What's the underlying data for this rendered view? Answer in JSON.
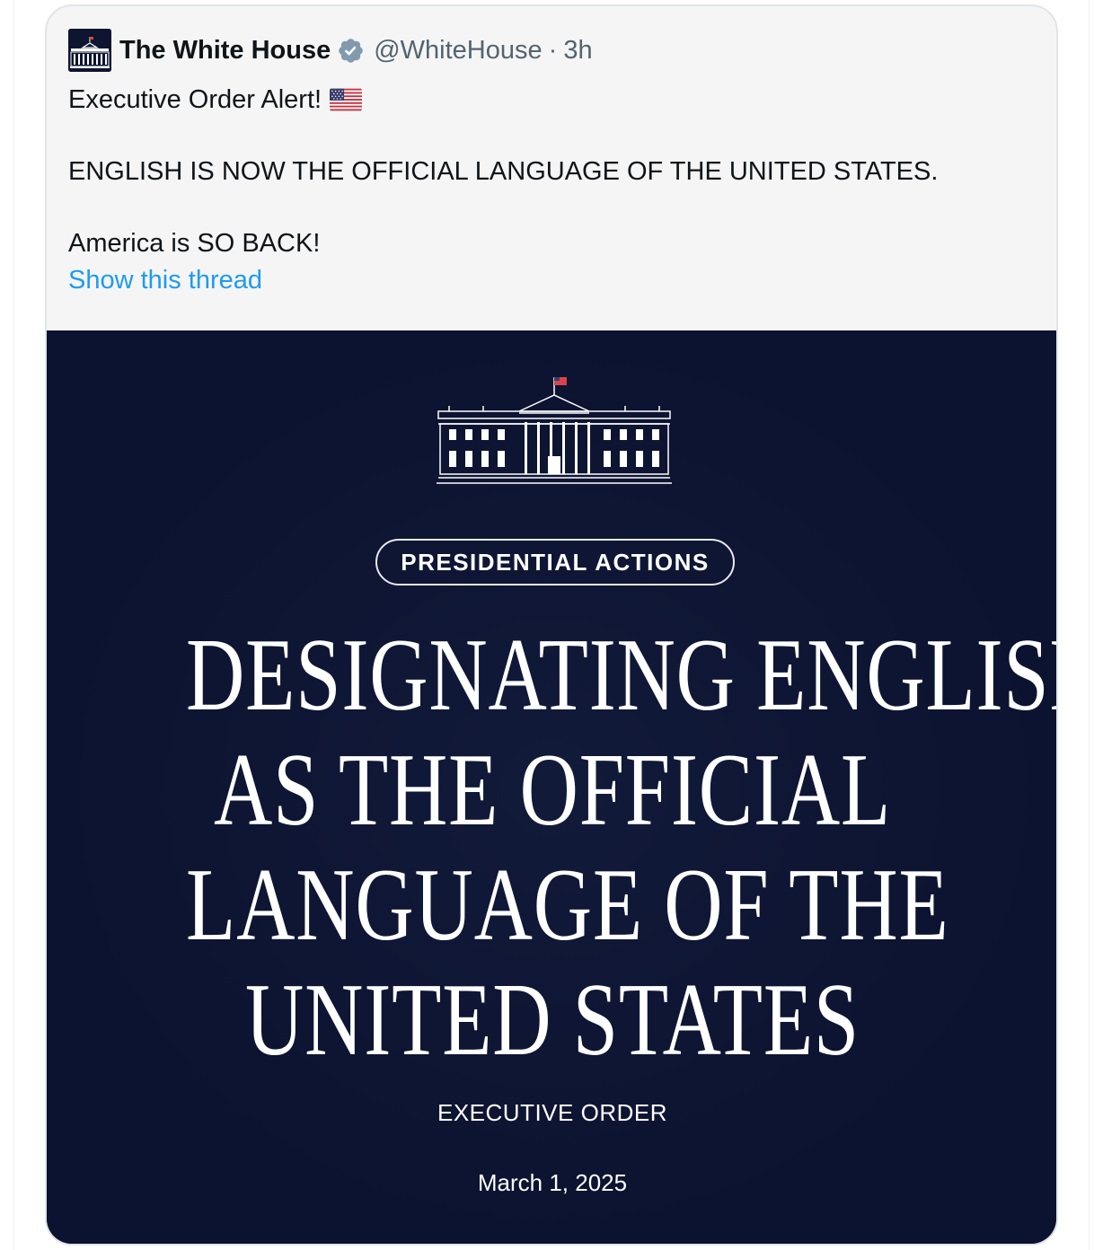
{
  "tweet": {
    "display_name": "The White House",
    "handle": "@WhiteHouse",
    "separator": "·",
    "time": "3h",
    "text_line1": "Executive Order Alert!",
    "text_line2": "ENGLISH IS NOW THE OFFICIAL LANGUAGE OF THE UNITED STATES.",
    "text_line3": "America is SO BACK!",
    "show_thread": "Show this thread",
    "icons": [
      "white-house-avatar-icon",
      "verified-badge-icon",
      "us-flag-icon"
    ],
    "colors": {
      "link": "#1d9bf0",
      "verified_badge": "#829aab",
      "media_background": "#0c1330"
    }
  },
  "media": {
    "badge": "PRESIDENTIAL ACTIONS",
    "headline_lines": [
      "DESIGNATING ENGLISH",
      "AS THE OFFICIAL",
      "LANGUAGE OF THE",
      "UNITED STATES"
    ],
    "subtitle": "EXECUTIVE ORDER",
    "date": "March 1, 2025"
  }
}
